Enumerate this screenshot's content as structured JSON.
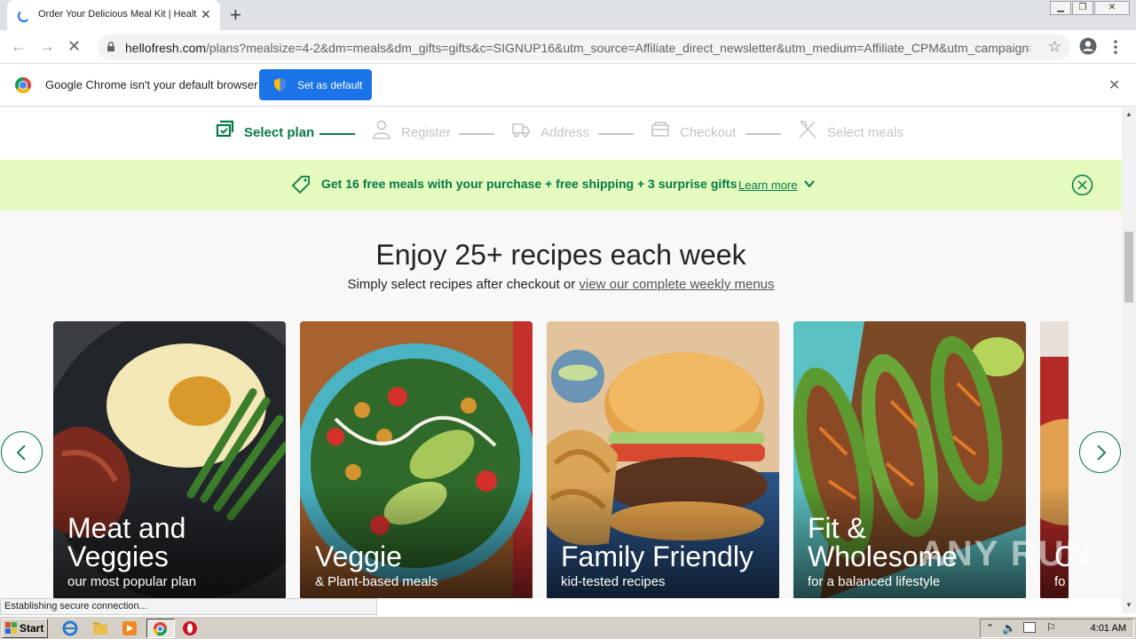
{
  "browser": {
    "tab_title": "Order Your Delicious Meal Kit | Healt",
    "url_host": "hellofresh.com",
    "url_rest": "/plans?mealsize=4-2&dm=meals&dm_gifts=gifts&c=SIGNUP16&utm_source=Affiliate_direct_newsletter&utm_medium=Affiliate_CPM&utm_campaign=...",
    "infobar_text": "Google Chrome isn't your default browser",
    "set_default_label": "Set as default",
    "status_text": "Establishing secure connection..."
  },
  "stepper": {
    "steps": [
      {
        "label": "Select plan"
      },
      {
        "label": "Register"
      },
      {
        "label": "Address"
      },
      {
        "label": "Checkout"
      },
      {
        "label": "Select meals"
      }
    ]
  },
  "promo": {
    "text": "Get 16 free meals with your purchase + free shipping + 3 surprise gifts",
    "link": "Learn more"
  },
  "hero": {
    "headline": "Enjoy 25+ recipes each week",
    "subline_prefix": "Simply select recipes after checkout or ",
    "subline_link": "view our complete weekly menus"
  },
  "cards": [
    {
      "title_line1": "Meat and",
      "title_line2": "Veggies",
      "subtitle": "our most popular plan"
    },
    {
      "title_line1": "",
      "title_line2": "Veggie",
      "subtitle": "& Plant-based meals"
    },
    {
      "title_line1": "",
      "title_line2": "Family Friendly",
      "subtitle": "kid-tested recipes"
    },
    {
      "title_line1": "Fit &",
      "title_line2": "Wholesome",
      "subtitle": "for a balanced lifestyle"
    },
    {
      "title_line1": "",
      "title_line2": "C",
      "subtitle": "fo"
    }
  ],
  "taskbar": {
    "start_label": "Start",
    "clock": "4:01 AM"
  },
  "watermark": "ANY RUN",
  "colors": {
    "brand_green": "#067a46",
    "promo_bg": "#e4fabf",
    "chrome_blue": "#1a73e8"
  },
  "icons": [
    "lock-icon",
    "star-icon",
    "account-icon",
    "menu-icon",
    "shield-icon",
    "close-icon",
    "tag-icon",
    "chevron-down-icon",
    "chevron-left-icon",
    "chevron-right-icon"
  ]
}
